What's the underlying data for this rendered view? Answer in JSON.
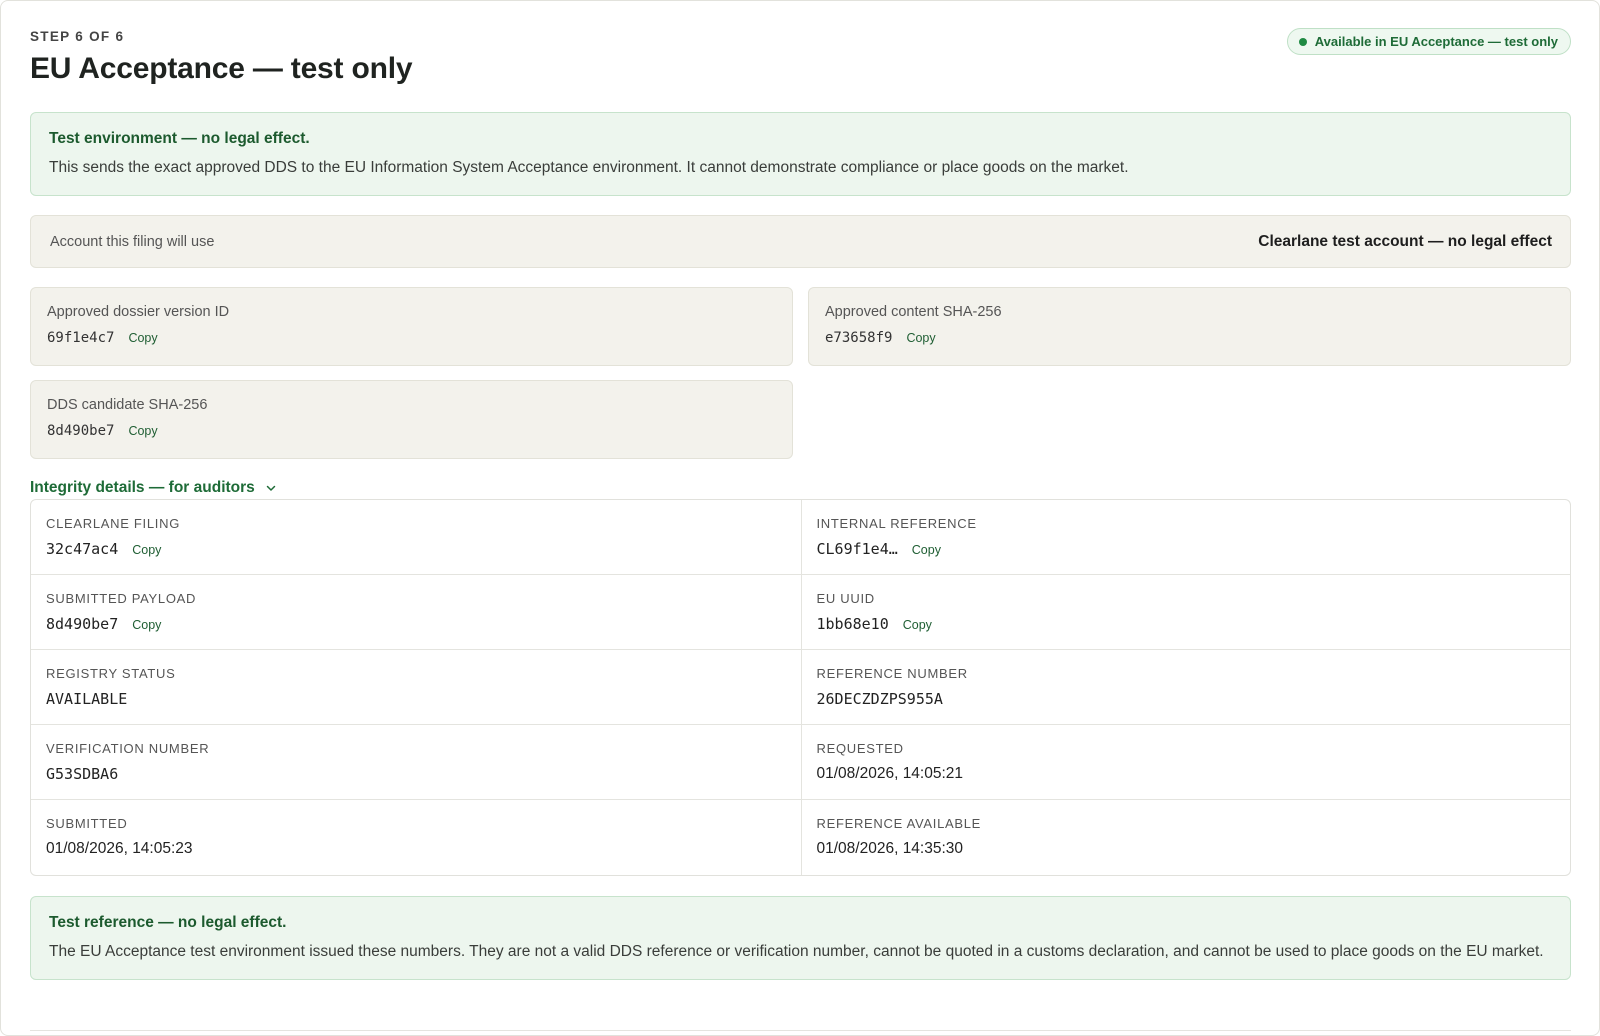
{
  "header": {
    "step": "STEP 6 OF 6",
    "title": "EU Acceptance — test only",
    "status_pill": "Available in EU Acceptance — test only",
    "status_color": "#1f8a43"
  },
  "test_notice": {
    "strong": "Test environment — no legal effect.",
    "body": "This sends the exact approved DDS to the EU Information System Acceptance environment. It cannot demonstrate compliance or place goods on the market."
  },
  "account": {
    "label": "Account this filing will use",
    "value": "Clearlane test account — no legal effect"
  },
  "cards": {
    "dossier": {
      "label": "Approved dossier version ID",
      "value": "69f1e4c7",
      "copy": "Copy"
    },
    "content_sha": {
      "label": "Approved content SHA-256",
      "value": "e73658f9",
      "copy": "Copy"
    },
    "dds_sha": {
      "label": "DDS candidate SHA-256",
      "value": "8d490be7",
      "copy": "Copy"
    }
  },
  "integrity": {
    "toggle_label": "Integrity details — for auditors",
    "rows": [
      [
        {
          "label": "CLEARLANE FILING",
          "value": "32c47ac4",
          "copy": "Copy"
        },
        {
          "label": "INTERNAL REFERENCE",
          "value": "CL69f1e4…",
          "copy": "Copy"
        }
      ],
      [
        {
          "label": "SUBMITTED PAYLOAD",
          "value": "8d490be7",
          "copy": "Copy"
        },
        {
          "label": "EU UUID",
          "value": "1bb68e10",
          "copy": "Copy"
        }
      ],
      [
        {
          "label": "REGISTRY STATUS",
          "value": "AVAILABLE"
        },
        {
          "label": "REFERENCE NUMBER",
          "value": "26DECZDZPS955A"
        }
      ],
      [
        {
          "label": "VERIFICATION NUMBER",
          "value": "G53SDBA6"
        },
        {
          "label": "REQUESTED",
          "value": "01/08/2026, 14:05:21"
        }
      ],
      [
        {
          "label": "SUBMITTED",
          "value": "01/08/2026, 14:05:23"
        },
        {
          "label": "REFERENCE AVAILABLE",
          "value": "01/08/2026, 14:35:30"
        }
      ]
    ]
  },
  "reference_notice": {
    "strong": "Test reference — no legal effect.",
    "body": "The EU Acceptance test environment issued these numbers. They are not a valid DDS reference or verification number, cannot be quoted in a customs declaration, and cannot be used to place goods on the EU market."
  }
}
